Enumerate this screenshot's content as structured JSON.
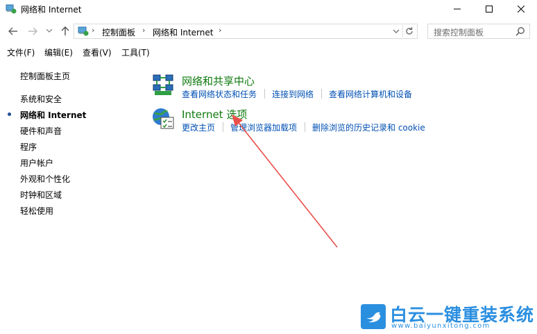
{
  "window": {
    "title": "网络和 Internet"
  },
  "address": {
    "crumbs": [
      "控制面板",
      "网络和 Internet"
    ]
  },
  "search": {
    "placeholder": "搜索控制面板"
  },
  "menu": {
    "file": "文件(F)",
    "edit": "编辑(E)",
    "view": "查看(V)",
    "tools": "工具(T)"
  },
  "sidebar": {
    "home": "控制面板主页",
    "items": [
      "系统和安全",
      "网络和 Internet",
      "硬件和声音",
      "程序",
      "用户帐户",
      "外观和个性化",
      "时钟和区域",
      "轻松使用"
    ],
    "active_index": 1
  },
  "categories": [
    {
      "title": "网络和共享中心",
      "icon": "network-sharing-center-icon",
      "links": [
        "查看网络状态和任务",
        "连接到网络",
        "查看网络计算机和设备"
      ]
    },
    {
      "title": "Internet 选项",
      "icon": "internet-options-icon",
      "links": [
        "更改主页",
        "管理浏览器加载项",
        "删除浏览的历史记录和 cookie"
      ]
    }
  ],
  "annotation": {
    "arrow_color": "#e8504b"
  },
  "watermark": {
    "main": "白云一键重装系统",
    "sub": "www.baiyunxitong.com",
    "color": "#2b8fe0"
  }
}
